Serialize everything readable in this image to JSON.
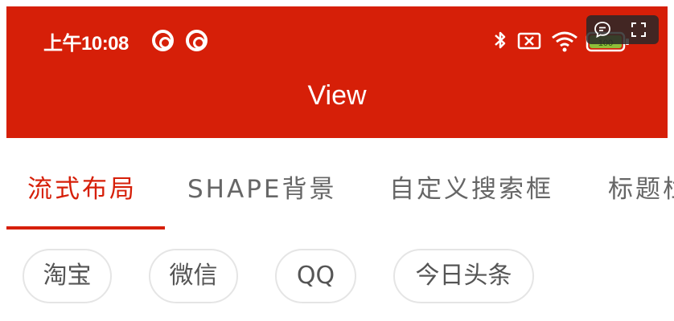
{
  "status_bar": {
    "time": "上午10:08",
    "icons": [
      "app-notification-icon",
      "app-notification-icon",
      "bluetooth-icon",
      "sim-off-icon",
      "wifi-icon",
      "battery-icon"
    ],
    "battery_level": "100"
  },
  "header": {
    "title": "View",
    "background": "#d61f08"
  },
  "overlay": {
    "icons": [
      "comment-icon",
      "fullscreen-icon"
    ]
  },
  "tabs": [
    {
      "label": "流式布局",
      "active": true
    },
    {
      "label": "SHAPE背景",
      "active": false
    },
    {
      "label": "自定义搜索框",
      "active": false
    },
    {
      "label": "标题栏",
      "active": false
    }
  ],
  "chips": [
    {
      "label": "淘宝"
    },
    {
      "label": "微信"
    },
    {
      "label": "QQ"
    },
    {
      "label": "今日头条"
    }
  ],
  "colors": {
    "accent": "#d61f08",
    "tab_inactive": "#666666",
    "chip_border": "#e5e5e5"
  }
}
